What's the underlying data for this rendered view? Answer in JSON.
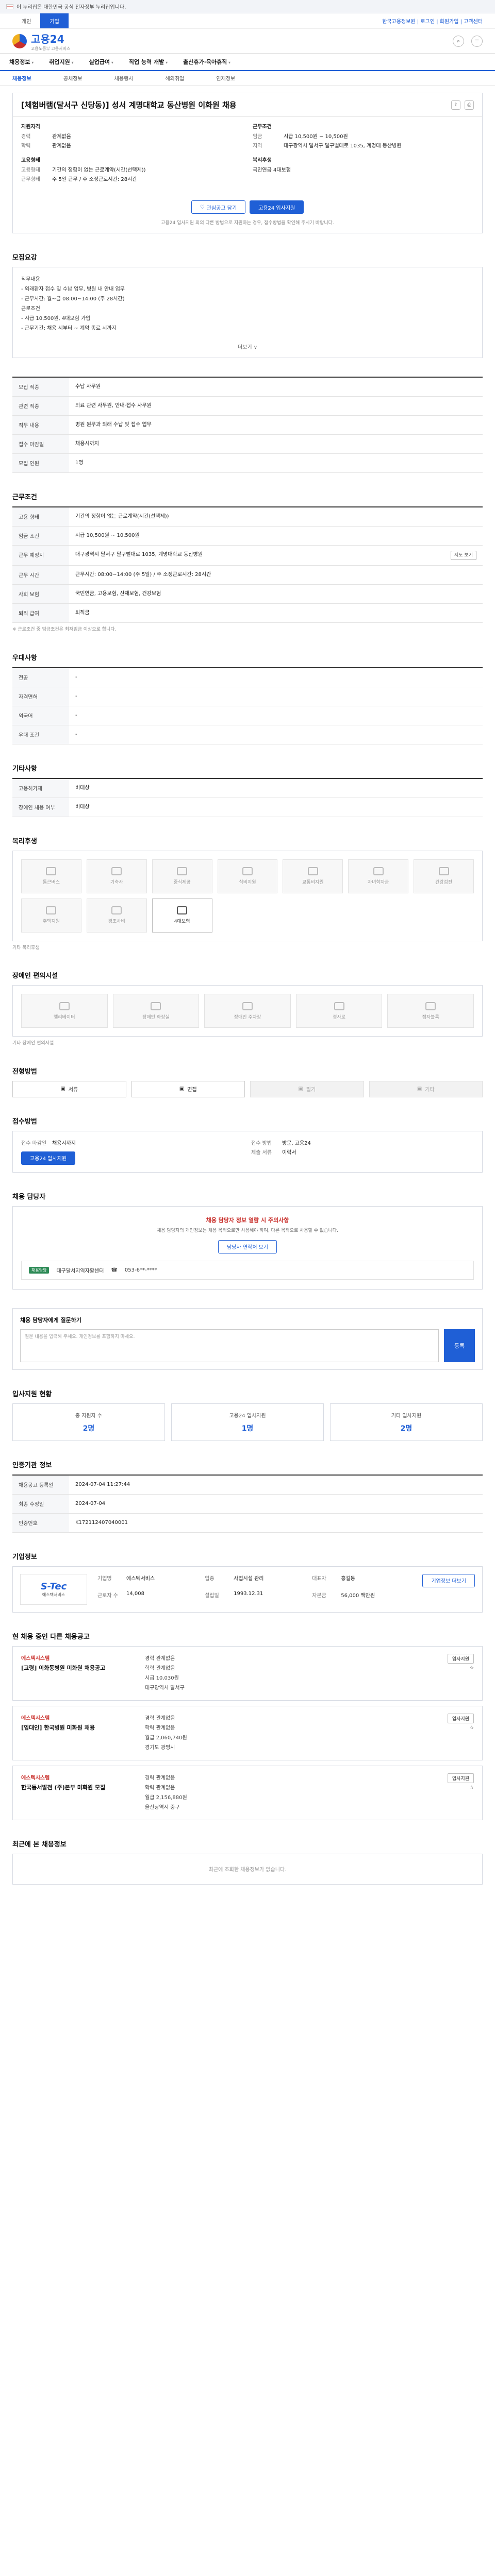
{
  "gov_banner": "이 누리집은 대한민국 공식 전자정부 누리집입니다.",
  "topnav": {
    "tabs": [
      "개인",
      "기업"
    ],
    "right": "한국고용정보원 | 로그인 | 회원가입 | 고객센터"
  },
  "header": {
    "logo": "고용24",
    "logo_sub": "고용노동부 고용서비스"
  },
  "mainnav": [
    "채용정보",
    "취업지원",
    "실업급여",
    "직업 능력 개발",
    "출산휴가·육아휴직"
  ],
  "subnav": [
    "채용정보",
    "공채정보",
    "채용행사",
    "해외취업",
    "인재정보"
  ],
  "job": {
    "title": "[체험버램(달서구 신당동)] 성서 계명대학교 동산병원 이화원 채용",
    "req_label": "지원자격",
    "work_label": "근무조건",
    "req": [
      {
        "k": "경력",
        "v": "관계없음"
      },
      {
        "k": "학력",
        "v": "관계없음"
      }
    ],
    "work": [
      {
        "k": "임금",
        "v": "시급 10,500원 ~ 10,500원"
      },
      {
        "k": "지역",
        "v": "대구광역시 달서구 달구벌대로 1035, 계명대 동산병원"
      }
    ],
    "type_label": "고용형태",
    "type_items": [
      {
        "k": "고용형태",
        "v": "기간의 정함이 없는 근로계약(시간(선택제))"
      },
      {
        "k": "근무형태",
        "v": "주 5일 근무 / 주 소정근로시간: 28시간"
      }
    ],
    "welfare_label": "복리후생",
    "welfare": "국민연금 4대보험",
    "btn_scrap": "관심공고 담기",
    "btn_apply": "고용24 입사지원",
    "notice": "고용24 입사지원 외의 다른 방법으로 지원하는 경우, 접수방법을 확인해 주시기 바랍니다."
  },
  "content": {
    "title": "모집요강",
    "lines": [
      "직무내용",
      "- 외래환자 접수 및 수납 업무, 병원 내 안내 업무",
      "- 근무시간: 월~금 08:00~14:00 (주 28시간)",
      "근로조건",
      "- 시급 10,500원, 4대보험 가입",
      "- 근무기간: 채용 시부터 ~ 계약 종료 시까지"
    ],
    "more": "더보기 ∨"
  },
  "recruit": {
    "rows": [
      {
        "th": "모집 직종",
        "td": "수납 사무원"
      },
      {
        "th": "관련 직종",
        "td": "의료 관련 사무원, 안내·접수 사무원"
      },
      {
        "th": "직무 내용",
        "td": "병원 원무과 외래 수납 및 접수 업무"
      },
      {
        "th": "접수 마감일",
        "td": "채용시까지"
      },
      {
        "th": "모집 인원",
        "td": "1명"
      }
    ]
  },
  "conditions": {
    "title": "근무조건",
    "rows": [
      {
        "th": "고용 형태",
        "td": "기간의 정함이 없는 근로계약(시간(선택제))"
      },
      {
        "th": "임금 조건",
        "td": "시급 10,500원 ~ 10,500원"
      },
      {
        "th": "근무 예정지",
        "td": "대구광역시 달서구 달구벌대로 1035, 계명대학교 동산병원"
      },
      {
        "th": "근무 시간",
        "td": "근무시간: 08:00~14:00 (주 5일) / 주 소정근로시간: 28시간"
      },
      {
        "th": "사회 보험",
        "td": "국민연금, 고용보험, 산재보험, 건강보험"
      },
      {
        "th": "퇴직 급여",
        "td": "퇴직금"
      }
    ],
    "tag": "지도 보기",
    "note": "※ 근로조건 중 임금조건은 최저임금 이상으로 합니다."
  },
  "prefs": {
    "title": "우대사항",
    "rows": [
      {
        "th": "전공",
        "td": "-"
      },
      {
        "th": "자격면허",
        "td": "-"
      },
      {
        "th": "외국어",
        "td": "-"
      },
      {
        "th": "우대 조건",
        "td": "-"
      }
    ]
  },
  "docs": {
    "title": "기타사항",
    "rows": [
      {
        "th": "고용허가제",
        "td": "비대상"
      },
      {
        "th": "장애인 채용 여부",
        "td": "비대상"
      }
    ]
  },
  "welfare_section": {
    "title": "복리후생",
    "items": [
      "통근버스",
      "기숙사",
      "중식제공",
      "식비지원",
      "교통비지원",
      "자녀학자금",
      "건강검진",
      "주택지원",
      "경조사비",
      "4대보험"
    ],
    "active": [
      "4대보험"
    ],
    "note": "기타 복리후생"
  },
  "facilities": {
    "title": "장애인 편의시설",
    "items": [
      "엘리베이터",
      "장애인 화장실",
      "장애인 주차장",
      "경사로",
      "점자블록"
    ],
    "note": "기타 장애인 편의시설"
  },
  "method": {
    "title": "전형방법",
    "items": [
      "서류",
      "면접",
      "필기",
      "기타"
    ],
    "active": [
      "서류",
      "면접"
    ]
  },
  "apply": {
    "title": "접수방법",
    "left_label": "접수 마감일",
    "left_value": "채용시까지",
    "right_label": "접수 방법",
    "right_value": "방문, 고용24",
    "btn": "고용24 입사지원",
    "docs_label": "제출 서류",
    "docs_value": "이력서"
  },
  "contact": {
    "title": "채용 담당자",
    "alert_title": "채용 담당자 정보 열람 시 주의사항",
    "alert_text": "채용 담당자의 개인정보는 채용 목적으로만 사용해야 하며, 다른 목적으로 사용할 수 없습니다.",
    "btn": "담당자 연락처 보기",
    "badge": "채용담당",
    "name": "대구달서지역자활센터",
    "phone": "053-6**-****"
  },
  "qa": {
    "title": "채용 담당자에게 질문하기",
    "placeholder": "질문 내용을 입력해 주세요. 개인정보를 포함하지 마세요.",
    "btn": "등록"
  },
  "stats": {
    "title": "입사지원 현황",
    "items": [
      {
        "lbl": "총 지원자 수",
        "val": "2명"
      },
      {
        "lbl": "고용24 입사지원",
        "val": "1명"
      },
      {
        "lbl": "기타 입사지원",
        "val": "2명"
      }
    ]
  },
  "info": {
    "title": "인증기관 정보",
    "rows": [
      {
        "th": "채용공고 등록일",
        "td": "2024-07-04 11:27:44"
      },
      {
        "th": "최종 수정일",
        "td": "2024-07-04"
      },
      {
        "th": "인증번호",
        "td": "K172112407040001"
      }
    ]
  },
  "company": {
    "title": "기업정보",
    "logo": "S-Tec",
    "logo_sub": "에스텍서비스",
    "fields": [
      {
        "k": "기업명",
        "v": "에스텍서비스"
      },
      {
        "k": "업종",
        "v": "사업시설 관리"
      },
      {
        "k": "대표자",
        "v": "홍길동"
      },
      {
        "k": "근로자 수",
        "v": "14,008"
      },
      {
        "k": "설립일",
        "v": "1993.12.31"
      },
      {
        "k": "자본금",
        "v": "56,000 백만원"
      }
    ],
    "btn": "기업정보 더보기"
  },
  "similar": {
    "title": "현 채용 중인 다른 채용공고",
    "jobs": [
      {
        "co": "에스텍시스템",
        "ttl": "[고령] 이화동병원 미화원 채용공고",
        "d1": "경력 관계없음",
        "d2": "학력 관계없음",
        "d3": "시급 10,030원",
        "d4": "대구광역시 달서구"
      },
      {
        "co": "에스텍시스템",
        "ttl": "[입대인] 한국병원 미화원 채용",
        "d1": "경력 관계없음",
        "d2": "학력 관계없음",
        "d3": "월급 2,060,740원",
        "d4": "경기도 광명시"
      },
      {
        "co": "에스텍시스템",
        "ttl": "한국동서발전 (주)본부 미화원 모집",
        "d1": "경력 관계없음",
        "d2": "학력 관계없음",
        "d3": "월급 2,156,880원",
        "d4": "울산광역시 중구"
      }
    ],
    "badge": "입사지원"
  },
  "recent": {
    "title": "최근에 본 채용정보",
    "empty": "최근에 조회한 채용정보가 없습니다."
  }
}
